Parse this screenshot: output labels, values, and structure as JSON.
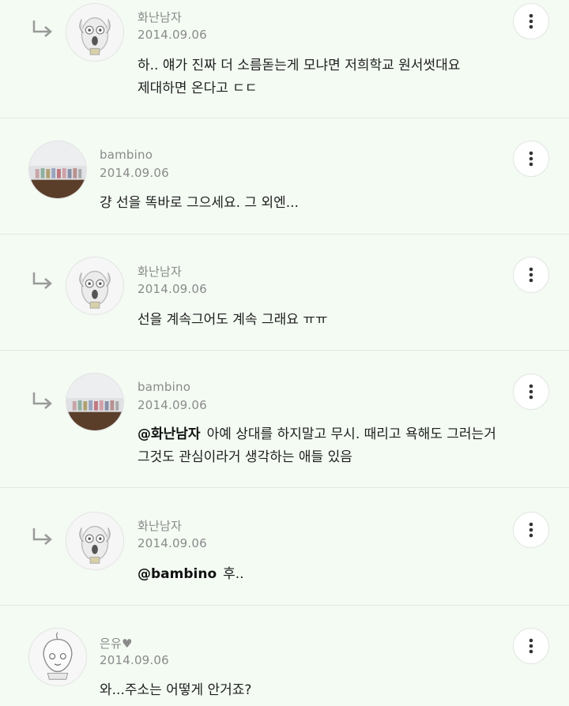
{
  "comments": [
    {
      "author": "화난남자",
      "date": "2014.09.06",
      "avatar_icon": "dog-character-avatar-icon",
      "reply_icon": "reply-arrow-icon",
      "more_icon": "more-vertical-icon",
      "text_line1": "하.. 얘가 진짜 더 소름돋는게 모냐면 저희학교 원서썻대요",
      "text_line2": "제대하면 온다고 ㄷㄷ"
    },
    {
      "author": "bambino",
      "date": "2014.09.06",
      "avatar_icon": "group-photo-avatar-icon",
      "more_icon": "more-vertical-icon",
      "text_line1": "걍 선을 똑바로 그으세요. 그 외엔..."
    },
    {
      "author": "화난남자",
      "date": "2014.09.06",
      "avatar_icon": "dog-character-avatar-icon",
      "reply_icon": "reply-arrow-icon",
      "more_icon": "more-vertical-icon",
      "text_line1": "선을 계속그어도 계속 그래요 ㅠㅠ"
    },
    {
      "author": "bambino",
      "date": "2014.09.06",
      "avatar_icon": "group-photo-avatar-icon",
      "reply_icon": "reply-arrow-icon",
      "more_icon": "more-vertical-icon",
      "mention": "@화난남자",
      "text_line1": "아예 상대를 하지말고 무시. 때리고 욕해도 그러는거",
      "text_line2": "그것도 관심이라거 생각하는 애들 있음"
    },
    {
      "author": "화난남자",
      "date": "2014.09.06",
      "avatar_icon": "dog-character-avatar-icon",
      "reply_icon": "reply-arrow-icon",
      "more_icon": "more-vertical-icon",
      "mention": "@bambino",
      "text_line1": "후.."
    },
    {
      "author": "은유♥",
      "date": "2014.09.06",
      "avatar_icon": "peach-character-avatar-icon",
      "more_icon": "more-vertical-icon",
      "text_line1": "와...주소는 어떻게 안거죠?"
    }
  ]
}
